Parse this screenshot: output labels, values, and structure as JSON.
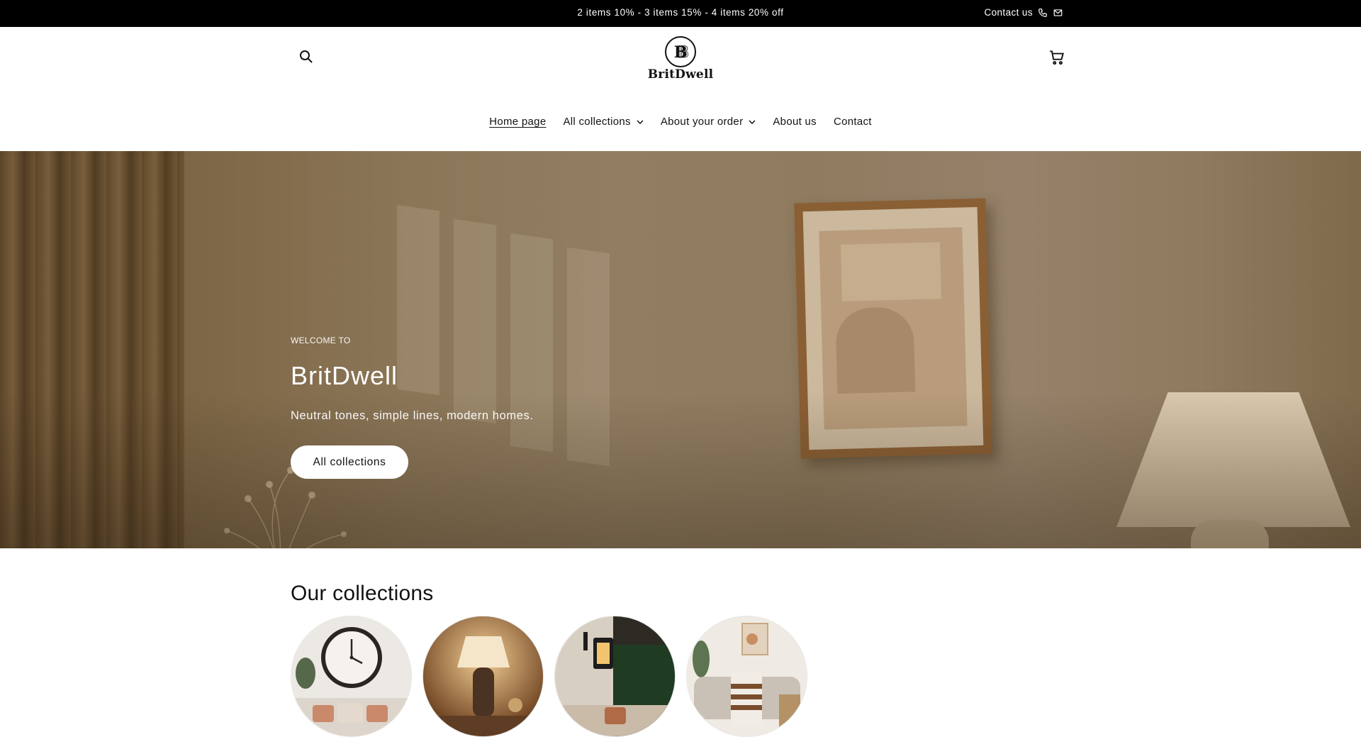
{
  "announcement": {
    "text": "2 items 10% - 3 items 15% - 4 items 20% off",
    "contact_label": "Contact us"
  },
  "header": {
    "logo_text": "BritDwell",
    "search_icon": "search-icon",
    "cart_icon": "cart-icon"
  },
  "nav": {
    "items": [
      {
        "label": "Home page",
        "active": true,
        "dropdown": false
      },
      {
        "label": "All collections",
        "active": false,
        "dropdown": true
      },
      {
        "label": "About your order",
        "active": false,
        "dropdown": true
      },
      {
        "label": "About us",
        "active": false,
        "dropdown": false
      },
      {
        "label": "Contact",
        "active": false,
        "dropdown": false
      }
    ]
  },
  "hero": {
    "kicker": "WELCOME TO",
    "title": "BritDwell",
    "subtitle": "Neutral tones, simple lines, modern homes.",
    "button_label": "All collections"
  },
  "collections": {
    "title": "Our collections"
  },
  "colors": {
    "announcement_bg": "#000000",
    "text": "#121212",
    "hero_tone": "#8b7658"
  }
}
